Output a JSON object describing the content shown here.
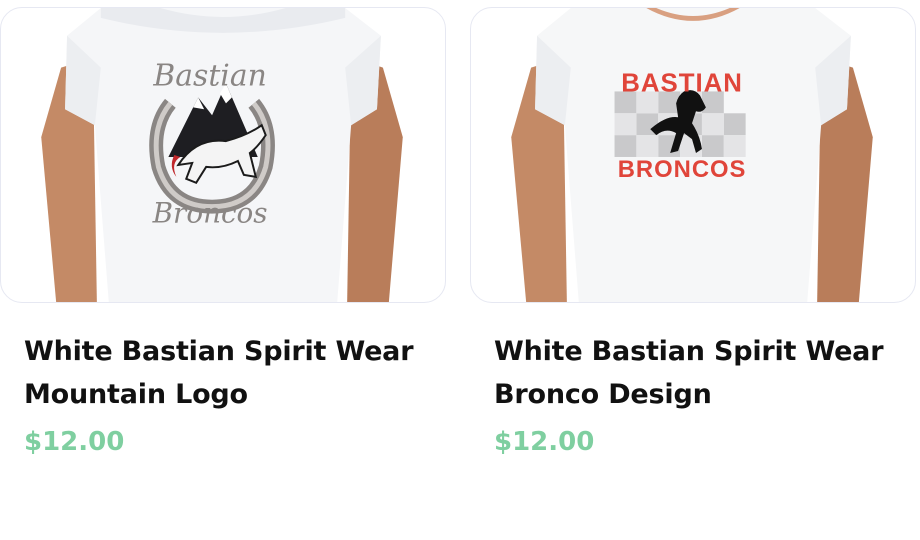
{
  "products": [
    {
      "title": "White Bastian Spirit Wear Mountain Logo",
      "price": "$12.00",
      "image_icon": "tshirt-mountain-logo-icon",
      "print_top": "Bastian",
      "print_bottom": "Broncos"
    },
    {
      "title": "White Bastian Spirit Wear Bronco Design",
      "price": "$12.00",
      "image_icon": "tshirt-bronco-design-icon",
      "print_top": "BASTIAN",
      "print_bottom": "BRONCOS"
    }
  ],
  "colors": {
    "price": "#7fcfa0",
    "title": "#111111",
    "border": "#e6e8f2",
    "brand_red": "#e0453a",
    "logo_gray": "#8a8684"
  }
}
